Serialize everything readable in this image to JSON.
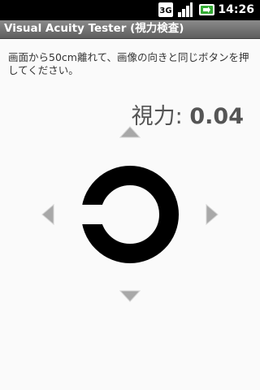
{
  "status_bar": {
    "network_label": "3G",
    "time": "14:26",
    "icons": [
      "3g-icon",
      "signal-icon",
      "battery-icon"
    ]
  },
  "app": {
    "title": "Visual Acuity Tester (視力検査)"
  },
  "instruction": "画面から50cm離れて、画像の向きと同じボタンを押してください。",
  "acuity": {
    "label": "視力:",
    "value": "0.04"
  },
  "test_symbol": {
    "name": "landolt-ring",
    "gap_direction": "left"
  },
  "controls": {
    "up": "arrow-up-icon",
    "down": "arrow-down-icon",
    "left": "arrow-left-icon",
    "right": "arrow-right-icon"
  },
  "colors": {
    "status_bar": "#000000",
    "title_bar": "#6e6e6e",
    "background": "#fafafa",
    "arrow": "#a8a8a8",
    "symbol": "#000000"
  }
}
